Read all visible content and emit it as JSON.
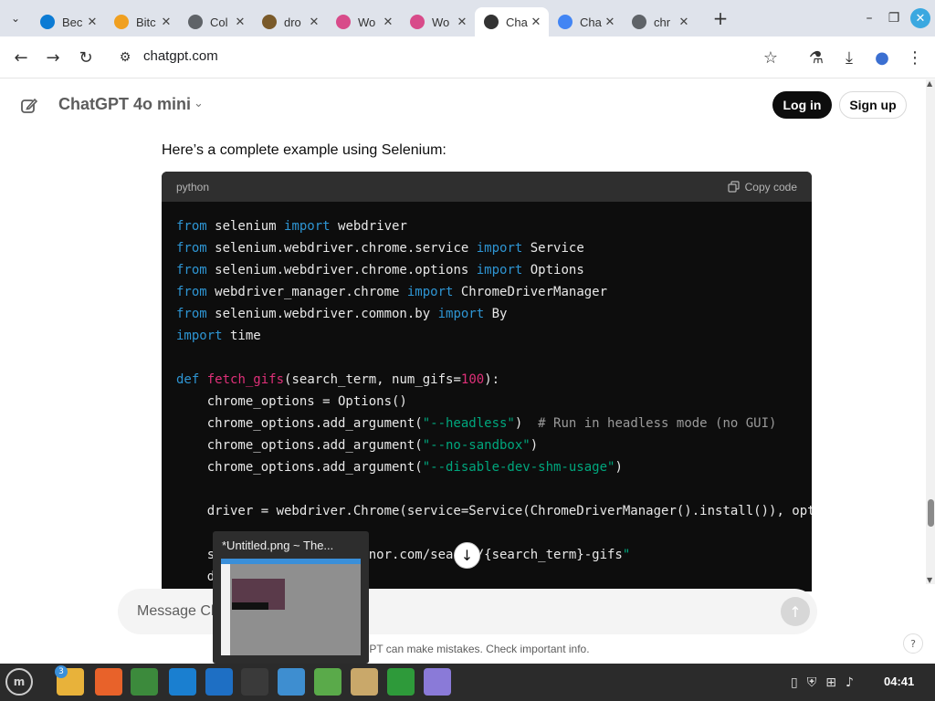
{
  "browser": {
    "tabs": [
      {
        "title": "Bec",
        "icon": "edge-icon",
        "color": "#0c7bd4"
      },
      {
        "title": "Bitc",
        "icon": "bitcoin-icon",
        "color": "#f0a020"
      },
      {
        "title": "Col",
        "icon": "globe-icon",
        "color": "#5f6368"
      },
      {
        "title": "dro",
        "icon": "image-favicon",
        "color": "#7a5a2a"
      },
      {
        "title": "Wo",
        "icon": "flower-icon",
        "color": "#d84b8a"
      },
      {
        "title": "Wo",
        "icon": "flower-icon",
        "color": "#d84b8a"
      },
      {
        "title": "Cha",
        "icon": "openai-icon",
        "color": "#333333",
        "active": true
      },
      {
        "title": "Cha",
        "icon": "google-icon",
        "color": "#4285f4"
      },
      {
        "title": "chr",
        "icon": "globe-icon",
        "color": "#5f6368"
      }
    ],
    "url": "chatgpt.com"
  },
  "chat": {
    "model": "ChatGPT 4o mini",
    "login_label": "Log in",
    "signup_label": "Sign up",
    "intro": "Here’s a complete example using Selenium:",
    "code_lang": "python",
    "copy_label": "Copy code",
    "composer_placeholder": "Message Ch",
    "disclaimer": "GPT can make mistakes. Check important info.",
    "help_label": "?"
  },
  "code_lines": [
    "from selenium import webdriver",
    "from selenium.webdriver.chrome.service import Service",
    "from selenium.webdriver.chrome.options import Options",
    "from webdriver_manager.chrome import ChromeDriverManager",
    "from selenium.webdriver.common.by import By",
    "import time",
    "",
    "def fetch_gifs(search_term, num_gifs=100):",
    "    chrome_options = Options()",
    "    chrome_options.add_argument(\"--headless\")  # Run in headless mode (no GUI)",
    "    chrome_options.add_argument(\"--no-sandbox\")",
    "    chrome_options.add_argument(\"--disable-dev-shm-usage\")",
    "",
    "    driver = webdriver.Chrome(service=Service(ChromeDriverManager().install()), opt",
    "",
    "    s                //tenor.com/search/{search_term}-gifs\"",
    "    d                )"
  ],
  "preview": {
    "title": "*Untitled.png ~ The..."
  },
  "taskbar": {
    "badge": "3",
    "time": "04:41",
    "apps": [
      {
        "name": "files-icon",
        "color": "#e8b23a"
      },
      {
        "name": "firefox-icon",
        "color": "#e8622a"
      },
      {
        "name": "chrome-icon",
        "color": "#3c8a3c"
      },
      {
        "name": "edge-dev-icon",
        "color": "#1a7fd0"
      },
      {
        "name": "remote-icon",
        "color": "#1e6fc4"
      },
      {
        "name": "terminal-icon",
        "color": "#3a3a3a"
      },
      {
        "name": "text-editor-icon",
        "color": "#3e8ed0"
      },
      {
        "name": "spreadsheet-icon",
        "color": "#5aaa4a"
      },
      {
        "name": "folder-icon",
        "color": "#c9a86a"
      },
      {
        "name": "shield-icon",
        "color": "#2e9a3a"
      },
      {
        "name": "notes-icon",
        "color": "#8a7ad8"
      }
    ]
  }
}
